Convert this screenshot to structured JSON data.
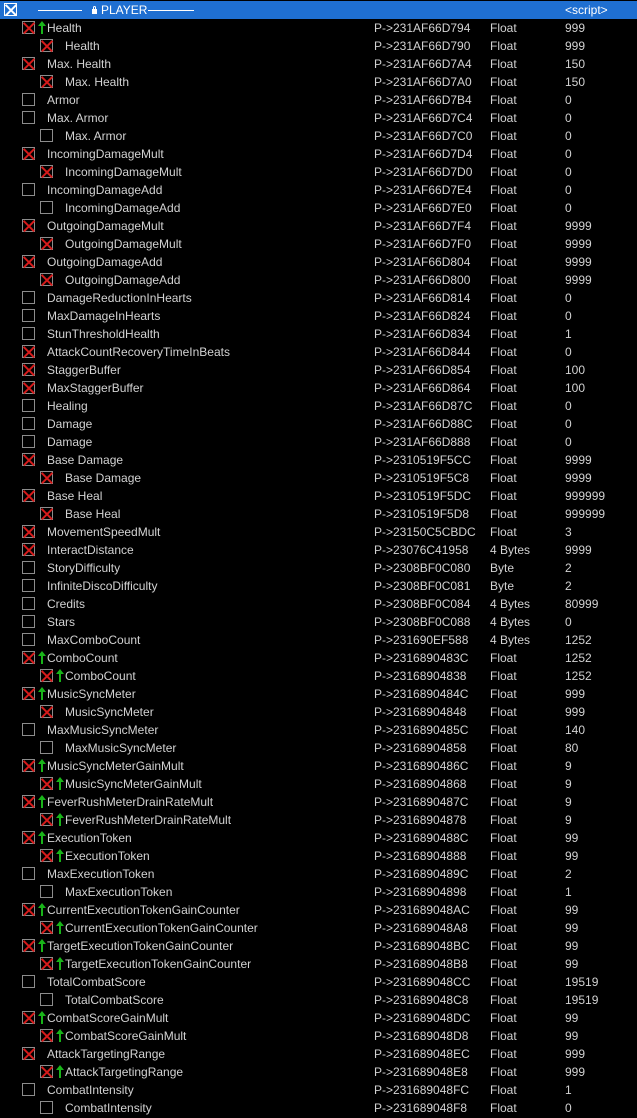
{
  "header": {
    "title": "PLAYER",
    "value": "<script>",
    "checked": true
  },
  "rows": [
    {
      "name": "Health",
      "level": 0,
      "checked": true,
      "arrow": true,
      "address": "P->231AF66D794",
      "type": "Float",
      "value": "999"
    },
    {
      "name": "Health",
      "level": 1,
      "checked": true,
      "arrow": false,
      "address": "P->231AF66D790",
      "type": "Float",
      "value": "999"
    },
    {
      "name": "Max. Health",
      "level": 0,
      "checked": true,
      "arrow": false,
      "address": "P->231AF66D7A4",
      "type": "Float",
      "value": "150"
    },
    {
      "name": "Max. Health",
      "level": 1,
      "checked": true,
      "arrow": false,
      "address": "P->231AF66D7A0",
      "type": "Float",
      "value": "150"
    },
    {
      "name": "Armor",
      "level": 0,
      "checked": false,
      "arrow": false,
      "address": "P->231AF66D7B4",
      "type": "Float",
      "value": "0"
    },
    {
      "name": "Max. Armor",
      "level": 0,
      "checked": false,
      "arrow": false,
      "address": "P->231AF66D7C4",
      "type": "Float",
      "value": "0"
    },
    {
      "name": "Max. Armor",
      "level": 1,
      "checked": false,
      "arrow": false,
      "address": "P->231AF66D7C0",
      "type": "Float",
      "value": "0"
    },
    {
      "name": "IncomingDamageMult",
      "level": 0,
      "checked": true,
      "arrow": false,
      "address": "P->231AF66D7D4",
      "type": "Float",
      "value": "0"
    },
    {
      "name": "IncomingDamageMult",
      "level": 1,
      "checked": true,
      "arrow": false,
      "address": "P->231AF66D7D0",
      "type": "Float",
      "value": "0"
    },
    {
      "name": "IncomingDamageAdd",
      "level": 0,
      "checked": false,
      "arrow": false,
      "address": "P->231AF66D7E4",
      "type": "Float",
      "value": "0"
    },
    {
      "name": "IncomingDamageAdd",
      "level": 1,
      "checked": false,
      "arrow": false,
      "address": "P->231AF66D7E0",
      "type": "Float",
      "value": "0"
    },
    {
      "name": "OutgoingDamageMult",
      "level": 0,
      "checked": true,
      "arrow": false,
      "address": "P->231AF66D7F4",
      "type": "Float",
      "value": "9999"
    },
    {
      "name": "OutgoingDamageMult",
      "level": 1,
      "checked": true,
      "arrow": false,
      "address": "P->231AF66D7F0",
      "type": "Float",
      "value": "9999"
    },
    {
      "name": "OutgoingDamageAdd",
      "level": 0,
      "checked": true,
      "arrow": false,
      "address": "P->231AF66D804",
      "type": "Float",
      "value": "9999"
    },
    {
      "name": "OutgoingDamageAdd",
      "level": 1,
      "checked": true,
      "arrow": false,
      "address": "P->231AF66D800",
      "type": "Float",
      "value": "9999"
    },
    {
      "name": "DamageReductionInHearts",
      "level": 0,
      "checked": false,
      "arrow": false,
      "address": "P->231AF66D814",
      "type": "Float",
      "value": "0"
    },
    {
      "name": "MaxDamageInHearts",
      "level": 0,
      "checked": false,
      "arrow": false,
      "address": "P->231AF66D824",
      "type": "Float",
      "value": "0"
    },
    {
      "name": "StunThresholdHealth",
      "level": 0,
      "checked": false,
      "arrow": false,
      "address": "P->231AF66D834",
      "type": "Float",
      "value": "1"
    },
    {
      "name": "AttackCountRecoveryTimeInBeats",
      "level": 0,
      "checked": true,
      "arrow": false,
      "address": "P->231AF66D844",
      "type": "Float",
      "value": "0"
    },
    {
      "name": "StaggerBuffer",
      "level": 0,
      "checked": true,
      "arrow": false,
      "address": "P->231AF66D854",
      "type": "Float",
      "value": "100"
    },
    {
      "name": "MaxStaggerBuffer",
      "level": 0,
      "checked": true,
      "arrow": false,
      "address": "P->231AF66D864",
      "type": "Float",
      "value": "100"
    },
    {
      "name": "Healing",
      "level": 0,
      "checked": false,
      "arrow": false,
      "address": "P->231AF66D87C",
      "type": "Float",
      "value": "0"
    },
    {
      "name": "Damage",
      "level": 0,
      "checked": false,
      "arrow": false,
      "address": "P->231AF66D88C",
      "type": "Float",
      "value": "0"
    },
    {
      "name": "Damage",
      "level": 0,
      "checked": false,
      "arrow": false,
      "address": "P->231AF66D888",
      "type": "Float",
      "value": "0"
    },
    {
      "name": "Base Damage",
      "level": 0,
      "checked": true,
      "arrow": false,
      "address": "P->2310519F5CC",
      "type": "Float",
      "value": "9999"
    },
    {
      "name": "Base Damage",
      "level": 1,
      "checked": true,
      "arrow": false,
      "address": "P->2310519F5C8",
      "type": "Float",
      "value": "9999"
    },
    {
      "name": "Base Heal",
      "level": 0,
      "checked": true,
      "arrow": false,
      "address": "P->2310519F5DC",
      "type": "Float",
      "value": "999999"
    },
    {
      "name": "Base Heal",
      "level": 1,
      "checked": true,
      "arrow": false,
      "address": "P->2310519F5D8",
      "type": "Float",
      "value": "999999"
    },
    {
      "name": "MovementSpeedMult",
      "level": 0,
      "checked": true,
      "arrow": false,
      "address": "P->23150C5CBDC",
      "type": "Float",
      "value": "3"
    },
    {
      "name": "InteractDistance",
      "level": 0,
      "checked": true,
      "arrow": false,
      "address": "P->23076C41958",
      "type": "4 Bytes",
      "value": "9999"
    },
    {
      "name": "StoryDifficulty",
      "level": 0,
      "checked": false,
      "arrow": false,
      "address": "P->2308BF0C080",
      "type": "Byte",
      "value": "2"
    },
    {
      "name": "InfiniteDiscoDifficulty",
      "level": 0,
      "checked": false,
      "arrow": false,
      "address": "P->2308BF0C081",
      "type": "Byte",
      "value": "2"
    },
    {
      "name": "Credits",
      "level": 0,
      "checked": false,
      "arrow": false,
      "address": "P->2308BF0C084",
      "type": "4 Bytes",
      "value": "80999"
    },
    {
      "name": "Stars",
      "level": 0,
      "checked": false,
      "arrow": false,
      "address": "P->2308BF0C088",
      "type": "4 Bytes",
      "value": "0"
    },
    {
      "name": "MaxComboCount",
      "level": 0,
      "checked": false,
      "arrow": false,
      "address": "P->231690EF588",
      "type": "4 Bytes",
      "value": "1252"
    },
    {
      "name": "ComboCount",
      "level": 0,
      "checked": true,
      "arrow": true,
      "address": "P->2316890483C",
      "type": "Float",
      "value": "1252"
    },
    {
      "name": "ComboCount",
      "level": 1,
      "checked": true,
      "arrow": true,
      "address": "P->23168904838",
      "type": "Float",
      "value": "1252"
    },
    {
      "name": "MusicSyncMeter",
      "level": 0,
      "checked": true,
      "arrow": true,
      "address": "P->2316890484C",
      "type": "Float",
      "value": "999"
    },
    {
      "name": "MusicSyncMeter",
      "level": 1,
      "checked": true,
      "arrow": false,
      "address": "P->23168904848",
      "type": "Float",
      "value": "999"
    },
    {
      "name": "MaxMusicSyncMeter",
      "level": 0,
      "checked": false,
      "arrow": false,
      "address": "P->2316890485C",
      "type": "Float",
      "value": "140"
    },
    {
      "name": "MaxMusicSyncMeter",
      "level": 1,
      "checked": false,
      "arrow": false,
      "address": "P->23168904858",
      "type": "Float",
      "value": "80"
    },
    {
      "name": "MusicSyncMeterGainMult",
      "level": 0,
      "checked": true,
      "arrow": true,
      "address": "P->2316890486C",
      "type": "Float",
      "value": "9"
    },
    {
      "name": "MusicSyncMeterGainMult",
      "level": 1,
      "checked": true,
      "arrow": true,
      "address": "P->23168904868",
      "type": "Float",
      "value": "9"
    },
    {
      "name": "FeverRushMeterDrainRateMult",
      "level": 0,
      "checked": true,
      "arrow": true,
      "address": "P->2316890487C",
      "type": "Float",
      "value": "9"
    },
    {
      "name": "FeverRushMeterDrainRateMult",
      "level": 1,
      "checked": true,
      "arrow": true,
      "address": "P->23168904878",
      "type": "Float",
      "value": "9"
    },
    {
      "name": "ExecutionToken",
      "level": 0,
      "checked": true,
      "arrow": true,
      "address": "P->2316890488C",
      "type": "Float",
      "value": "99"
    },
    {
      "name": "ExecutionToken",
      "level": 1,
      "checked": true,
      "arrow": true,
      "address": "P->23168904888",
      "type": "Float",
      "value": "99"
    },
    {
      "name": "MaxExecutionToken",
      "level": 0,
      "checked": false,
      "arrow": false,
      "address": "P->2316890489C",
      "type": "Float",
      "value": "2"
    },
    {
      "name": "MaxExecutionToken",
      "level": 1,
      "checked": false,
      "arrow": false,
      "address": "P->23168904898",
      "type": "Float",
      "value": "1"
    },
    {
      "name": "CurrentExecutionTokenGainCounter",
      "level": 0,
      "checked": true,
      "arrow": true,
      "address": "P->231689048AC",
      "type": "Float",
      "value": "99"
    },
    {
      "name": "CurrentExecutionTokenGainCounter",
      "level": 1,
      "checked": true,
      "arrow": true,
      "address": "P->231689048A8",
      "type": "Float",
      "value": "99"
    },
    {
      "name": "TargetExecutionTokenGainCounter",
      "level": 0,
      "checked": true,
      "arrow": true,
      "address": "P->231689048BC",
      "type": "Float",
      "value": "99"
    },
    {
      "name": "TargetExecutionTokenGainCounter",
      "level": 1,
      "checked": true,
      "arrow": true,
      "address": "P->231689048B8",
      "type": "Float",
      "value": "99"
    },
    {
      "name": "TotalCombatScore",
      "level": 0,
      "checked": false,
      "arrow": false,
      "address": "P->231689048CC",
      "type": "Float",
      "value": "19519"
    },
    {
      "name": "TotalCombatScore",
      "level": 1,
      "checked": false,
      "arrow": false,
      "address": "P->231689048C8",
      "type": "Float",
      "value": "19519"
    },
    {
      "name": "CombatScoreGainMult",
      "level": 0,
      "checked": true,
      "arrow": true,
      "address": "P->231689048DC",
      "type": "Float",
      "value": "99"
    },
    {
      "name": "CombatScoreGainMult",
      "level": 1,
      "checked": true,
      "arrow": true,
      "address": "P->231689048D8",
      "type": "Float",
      "value": "99"
    },
    {
      "name": "AttackTargetingRange",
      "level": 0,
      "checked": true,
      "arrow": false,
      "address": "P->231689048EC",
      "type": "Float",
      "value": "999"
    },
    {
      "name": "AttackTargetingRange",
      "level": 1,
      "checked": true,
      "arrow": true,
      "address": "P->231689048E8",
      "type": "Float",
      "value": "999"
    },
    {
      "name": "CombatIntensity",
      "level": 0,
      "checked": false,
      "arrow": false,
      "address": "P->231689048FC",
      "type": "Float",
      "value": "1"
    },
    {
      "name": "CombatIntensity",
      "level": 1,
      "checked": false,
      "arrow": false,
      "address": "P->231689048F8",
      "type": "Float",
      "value": "0"
    }
  ]
}
